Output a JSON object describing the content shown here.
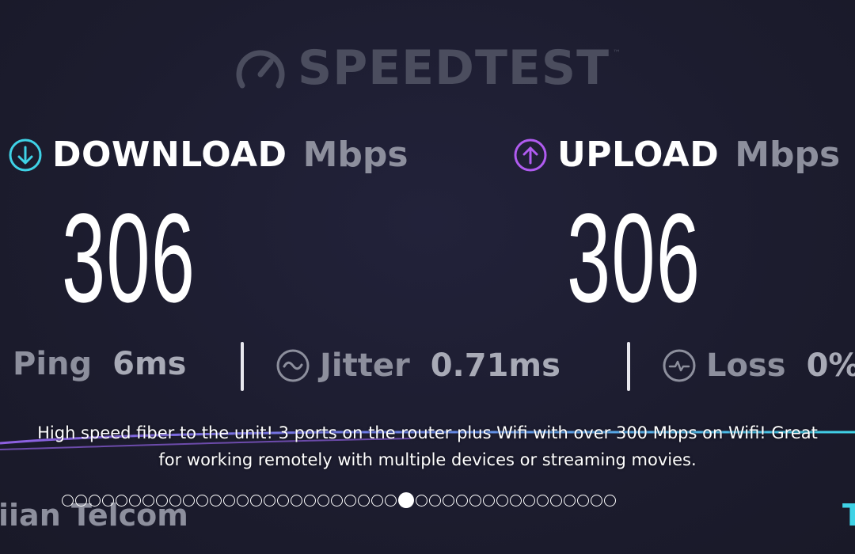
{
  "logo": {
    "text": "SPEEDTEST",
    "icon": "gauge-icon",
    "trademark": "™"
  },
  "download": {
    "icon": "arrow-down-circle-icon",
    "label": "DOWNLOAD",
    "unit": "Mbps",
    "value": "306",
    "accent": "#3fd2e6"
  },
  "upload": {
    "icon": "arrow-up-circle-icon",
    "label": "UPLOAD",
    "unit": "Mbps",
    "value": "306",
    "accent": "#b05bf0"
  },
  "stats": {
    "ping_label": "Ping",
    "ping_value": "6ms",
    "jitter_icon": "wave-circle-icon",
    "jitter_label": "Jitter",
    "jitter_value": "0.71ms",
    "loss_icon": "pulse-circle-icon",
    "loss_label": "Loss",
    "loss_value": "0%"
  },
  "caption": "High speed fiber to the unit! 3 ports on the router plus Wifi with over 300 Mbps on Wifi! Great for working remotely with multiple devices or streaming movies.",
  "provider": {
    "name": "iian Telcom",
    "right_fragment": "T"
  },
  "pagination": {
    "total": 41,
    "active_index": 25
  }
}
